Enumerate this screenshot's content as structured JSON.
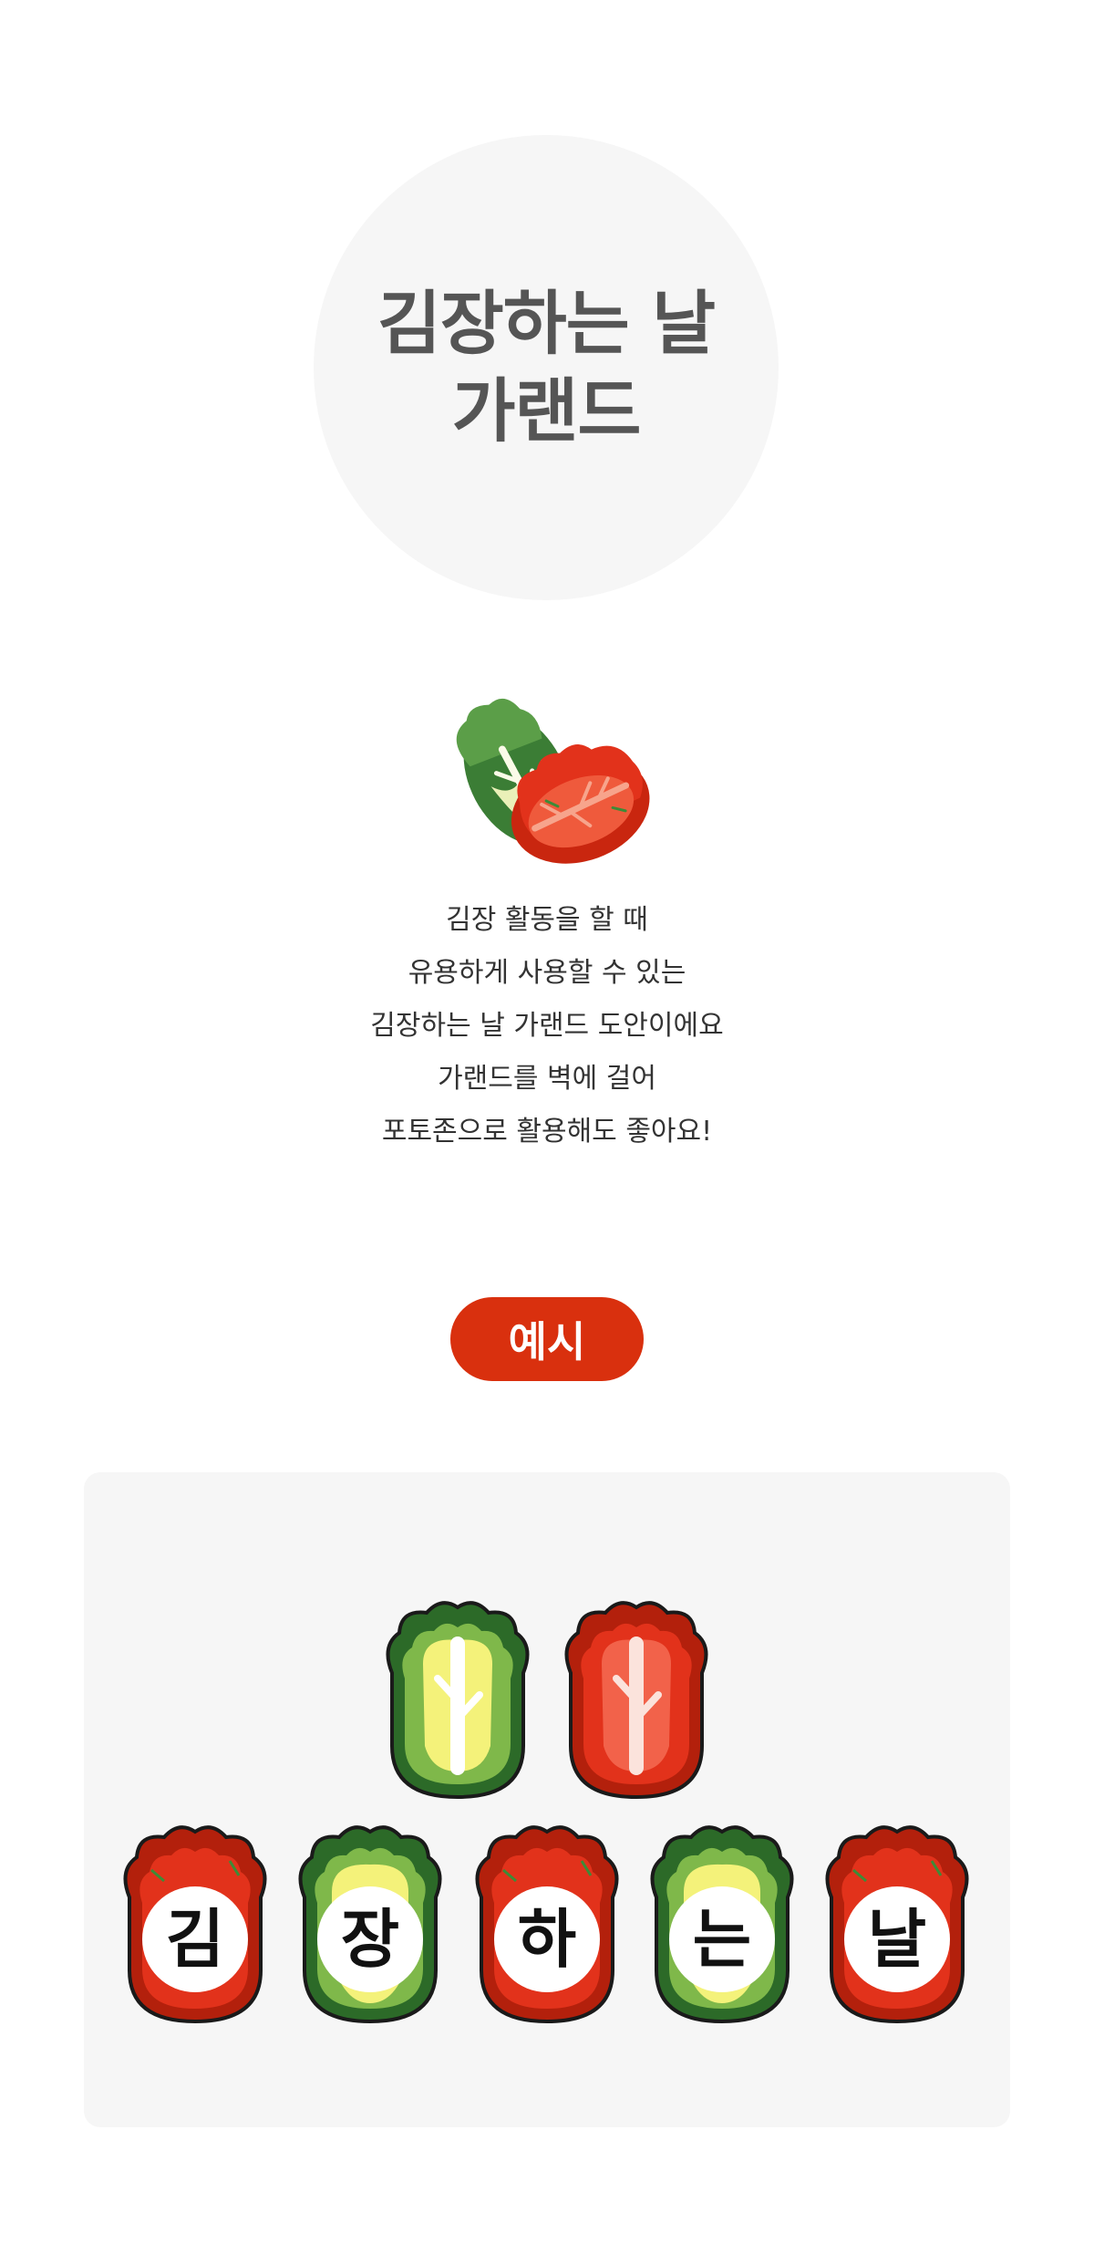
{
  "header": {
    "title_line1": "김장하는 날",
    "title_line2": "가랜드"
  },
  "hero": {
    "illustration": "napa-cabbage-and-kimchi-icon"
  },
  "description": {
    "lines": [
      "김장 활동을 할 때",
      "유용하게 사용할 수 있는",
      "김장하는 날 가랜드 도안이에요",
      "가랜드를 벽에 걸어",
      "포토존으로 활용해도 좋아요!"
    ]
  },
  "example": {
    "badge_label": "예시",
    "top_pieces": [
      "cabbage-icon",
      "kimchi-icon"
    ],
    "letters": [
      "김",
      "장",
      "하",
      "는",
      "날"
    ]
  },
  "colors": {
    "accent_red": "#d9300e",
    "title_gray": "#555555",
    "kimchi_red": "#e2321b",
    "cabbage_green": "#3d8b37",
    "cabbage_yellow": "#f4f27a"
  }
}
